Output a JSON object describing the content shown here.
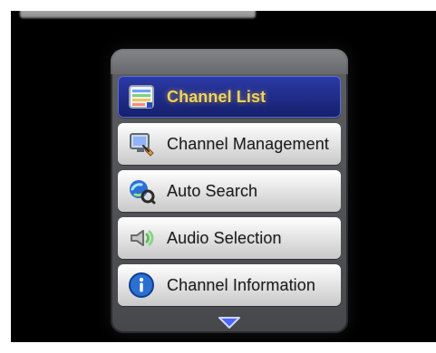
{
  "menu": {
    "items": [
      {
        "label": "Channel List",
        "icon": "channel-list-icon",
        "selected": true
      },
      {
        "label": "Channel Management",
        "icon": "channel-management-icon",
        "selected": false
      },
      {
        "label": "Auto Search",
        "icon": "auto-search-icon",
        "selected": false
      },
      {
        "label": "Audio Selection",
        "icon": "audio-selection-icon",
        "selected": false
      },
      {
        "label": "Channel Information",
        "icon": "channel-information-icon",
        "selected": false
      }
    ],
    "scroll_indicator_icon": "down-arrow-icon",
    "colors": {
      "selected_bg": "#1f2b86",
      "selected_text": "#f2d35c",
      "item_bg": "#e6e6e6",
      "item_text": "#1d1d1d",
      "panel_bg": "#5a5c60",
      "screen_bg": "#000000"
    }
  }
}
